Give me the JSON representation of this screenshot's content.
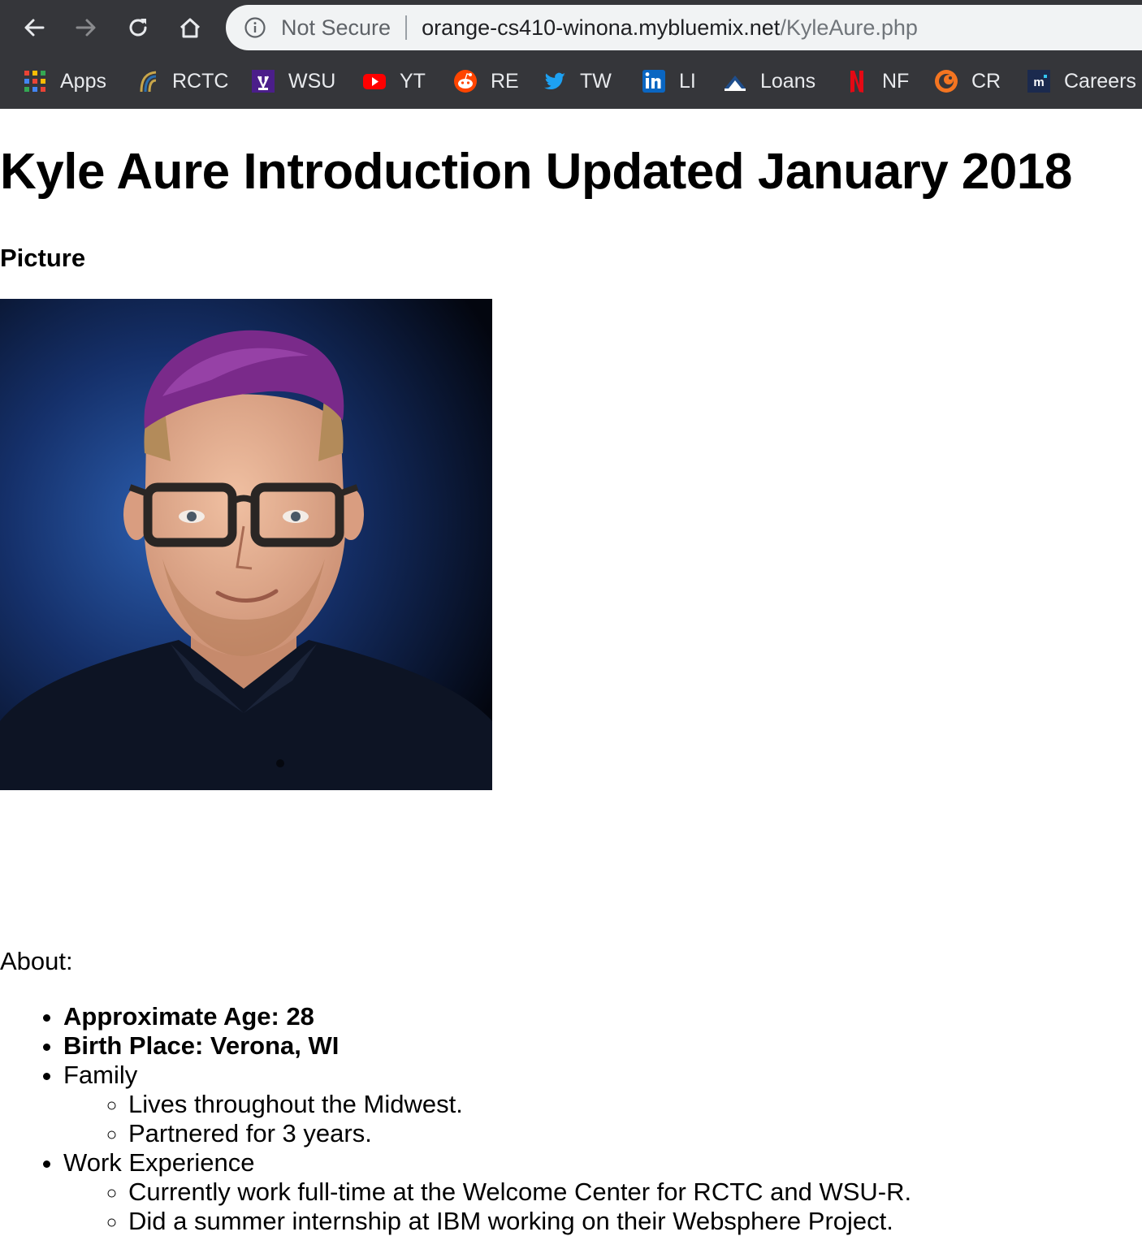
{
  "browser": {
    "security_label": "Not Secure",
    "url_host": "orange-cs410-winona.mybluemix.net",
    "url_path": "/KyleAure.php",
    "bookmarks": [
      {
        "label": "Apps",
        "icon": "apps-grid-icon"
      },
      {
        "label": "RCTC",
        "icon": "rctc-logo-icon"
      },
      {
        "label": "WSU",
        "icon": "wsu-logo-icon"
      },
      {
        "label": "YT",
        "icon": "youtube-icon"
      },
      {
        "label": "RE",
        "icon": "reddit-icon"
      },
      {
        "label": "TW",
        "icon": "twitter-icon"
      },
      {
        "label": "LI",
        "icon": "linkedin-icon"
      },
      {
        "label": "Loans",
        "icon": "loans-icon"
      },
      {
        "label": "NF",
        "icon": "netflix-icon"
      },
      {
        "label": "CR",
        "icon": "crunchyroll-icon"
      },
      {
        "label": "Careers",
        "icon": "careers-icon"
      }
    ]
  },
  "page": {
    "title": "Kyle Aure Introduction Updated January 2018",
    "picture_heading": "Picture",
    "about_label": "About:",
    "about": {
      "age": "Approximate Age: 28",
      "birth_place": "Birth Place: Verona, WI",
      "family": "Family",
      "family_items": [
        "Lives throughout the Midwest.",
        "Partnered for 3 years."
      ],
      "work": "Work Experience",
      "work_items": [
        "Currently work full-time at the Welcome Center for RCTC and WSU-R.",
        "Did a summer internship at IBM working on their Websphere Project."
      ]
    }
  },
  "colors": {
    "chrome_bg": "#35363a",
    "omnibox_bg": "#f1f3f4",
    "hair": "#7a2a8a"
  }
}
